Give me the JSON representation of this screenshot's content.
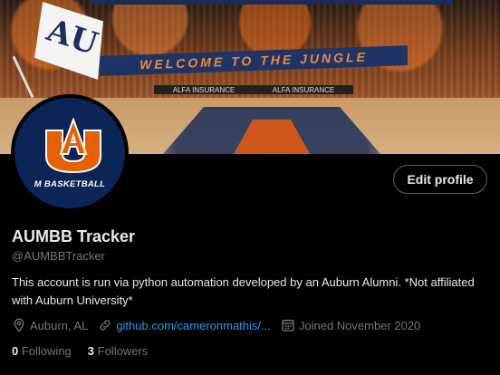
{
  "profile": {
    "display_name": "AUMBB Tracker",
    "handle": "@AUMBBTracker",
    "bio": "This account is run via python automation developed by an Auburn Alumni. *Not affiliated with Auburn University*",
    "edit_button_label": "Edit profile",
    "avatar_text": "M BASKETBALL",
    "location": "Auburn, AL",
    "location_icon": "location-pin-icon",
    "website": "github.com/cameronmathis/...",
    "website_icon": "link-icon",
    "joined": "Joined November 2020",
    "joined_icon": "calendar-icon"
  },
  "stats": {
    "following_count": "0",
    "following_label": "Following",
    "followers_count": "3",
    "followers_label": "Followers"
  },
  "banner": {
    "sign_text": "WELCOME TO THE JUNGLE",
    "ad_text": "ALFA INSURANCE"
  },
  "colors": {
    "background": "#000000",
    "text_primary": "#e7e9ea",
    "text_secondary": "#71767b",
    "link": "#1d9bf0",
    "auburn_navy": "#0c2557",
    "auburn_orange": "#e86100"
  }
}
